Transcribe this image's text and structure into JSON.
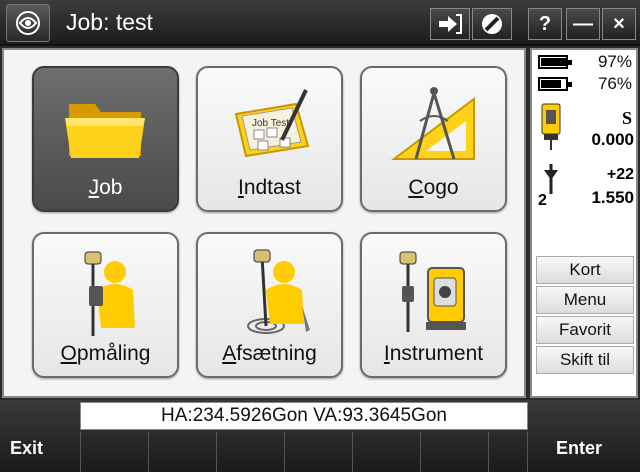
{
  "titlebar": {
    "title": "Job: test",
    "help_label": "?",
    "minimize_label": "—",
    "close_label": "×"
  },
  "tiles": [
    {
      "label": "Job",
      "icon": "folder-icon",
      "hotkey": "J",
      "rest": "ob",
      "selected": true
    },
    {
      "label": "Indtast",
      "icon": "keypad-entry-icon",
      "hotkey": "I",
      "rest": "ndtast"
    },
    {
      "label": "Cogo",
      "icon": "compass-triangle-icon",
      "hotkey": "C",
      "rest": "ogo"
    },
    {
      "label": "Opmåling",
      "icon": "surveyor-measure-icon",
      "hotkey": "O",
      "rest": "pmåling"
    },
    {
      "label": "Afsætning",
      "icon": "surveyor-stakeout-icon",
      "hotkey": "A",
      "rest": "fsætning"
    },
    {
      "label": "Instrument",
      "icon": "total-station-icon",
      "hotkey": "I",
      "rest": "nstrument"
    }
  ],
  "status_panel": {
    "battery1_pct": "97%",
    "battery2_pct": "76%",
    "instrument_mode": "S",
    "instrument_value": "0.000",
    "target_offset": "+22",
    "target_number": "2",
    "target_height": "1.550"
  },
  "side_buttons": [
    {
      "label": "Kort"
    },
    {
      "label": "Menu"
    },
    {
      "label": "Favorit"
    },
    {
      "label": "Skift til"
    }
  ],
  "status_line": "HA:234.5926Gon  VA:93.3645Gon",
  "softkeys": {
    "exit": "Exit",
    "enter": "Enter"
  }
}
